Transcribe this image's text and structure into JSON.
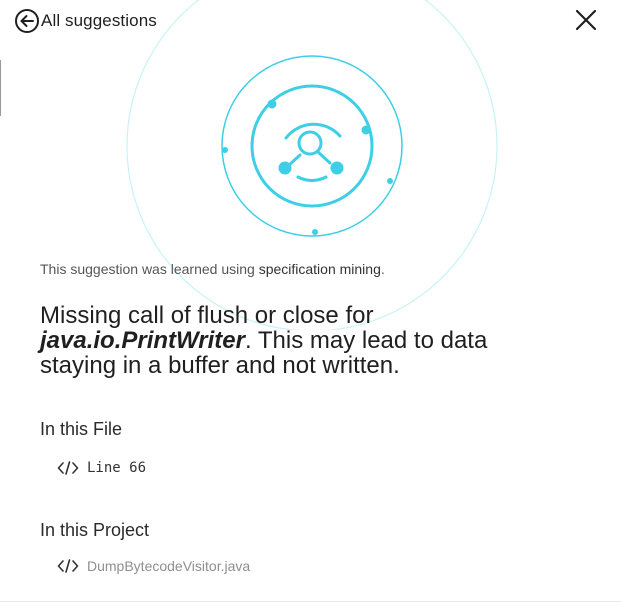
{
  "header": {
    "back_label": "All suggestions",
    "back_icon": "circle-arrow-left-icon",
    "close_icon": "close-icon"
  },
  "illustration": {
    "icon": "specification-mining-search-icon",
    "accent_color": "#3ccfe6",
    "ring_color": "#c8f3f5"
  },
  "learned_note": {
    "prefix": "This suggestion was learned using ",
    "method": "specification mining",
    "suffix": "."
  },
  "suggestion": {
    "line1": "Missing call of flush or close for",
    "class_name": "java.io.PrintWriter",
    "after_class": ". This may lead to data",
    "line3": "staying in a buffer and not written."
  },
  "in_file": {
    "title": "In this File",
    "items": [
      {
        "icon": "code-icon",
        "label": "Line 66"
      }
    ]
  },
  "in_project": {
    "title": "In this Project",
    "items": [
      {
        "icon": "code-icon",
        "label": "DumpBytecodeVisitor.java"
      }
    ]
  }
}
